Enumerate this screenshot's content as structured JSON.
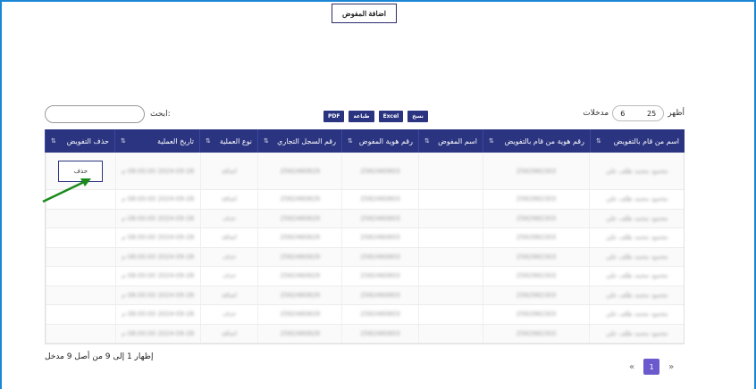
{
  "toolbar": {
    "add_delegate_label": "اضافة المفوض"
  },
  "length_control": {
    "show_label": "أظهر",
    "value": "25",
    "other_value": "6",
    "entries_label": "مدخلات"
  },
  "search": {
    "label": "ابحث:"
  },
  "export_buttons": [
    "نسخ",
    "Excel",
    "طباعة",
    "PDF"
  ],
  "table": {
    "headers": [
      "اسم من قام بالتفويض",
      "رقم هوية من قام بالتفويض",
      "اسم المفوض",
      "رقم هوية المفوض",
      "رقم السجل التجاري",
      "نوع العملية",
      "تاريخ العملية",
      "حذف التفويض"
    ],
    "rows": [
      [
        "محمود محمد طلف علي",
        "2582982303",
        "",
        "2582460803",
        "2582460829",
        "اضافة",
        "2024-09-28 08:00:00 م",
        "حذف"
      ],
      [
        "محمود محمد طلف علي",
        "2582982303",
        "",
        "2582460803",
        "2582460829",
        "اضافة",
        "2024-09-28 08:00:00 م",
        ""
      ],
      [
        "محمود محمد طلف علي",
        "2582982303",
        "",
        "2582460803",
        "2582460829",
        "حذف",
        "2024-09-28 08:00:00 م",
        ""
      ],
      [
        "محمود محمد طلف علي",
        "2582982303",
        "",
        "2582460803",
        "2582460829",
        "اضافة",
        "2024-09-28 08:00:00 م",
        ""
      ],
      [
        "محمود محمد طلف علي",
        "2582982303",
        "",
        "2582460803",
        "2582460829",
        "حذف",
        "2024-09-28 08:00:00 م",
        ""
      ],
      [
        "محمود محمد طلف علي",
        "2582982303",
        "",
        "2582460803",
        "2582460829",
        "حذف",
        "2024-09-28 08:00:00 م",
        ""
      ],
      [
        "محمود محمد طلف علي",
        "2582982303",
        "",
        "2582460803",
        "2582460829",
        "اضافة",
        "2024-09-28 08:00:00 م",
        ""
      ],
      [
        "محمود محمد طلف علي",
        "2582982303",
        "",
        "2582460803",
        "2582460829",
        "حذف",
        "2024-09-28 08:00:00 م",
        ""
      ],
      [
        "محمود محمد طلف علي",
        "2582982303",
        "",
        "2582460803",
        "2582460829",
        "اضافة",
        "2024-09-28 08:00:00 م",
        ""
      ]
    ]
  },
  "info_text": "إظهار 1 إلى 9 من أصل 9 مدخل",
  "pagination": {
    "prev": "«",
    "current": "1",
    "next": "»"
  },
  "colors": {
    "header_bg": "#2a3480",
    "accent": "#6a5acd",
    "frame": "#1a86d6",
    "arrow": "#1a8a1a"
  }
}
